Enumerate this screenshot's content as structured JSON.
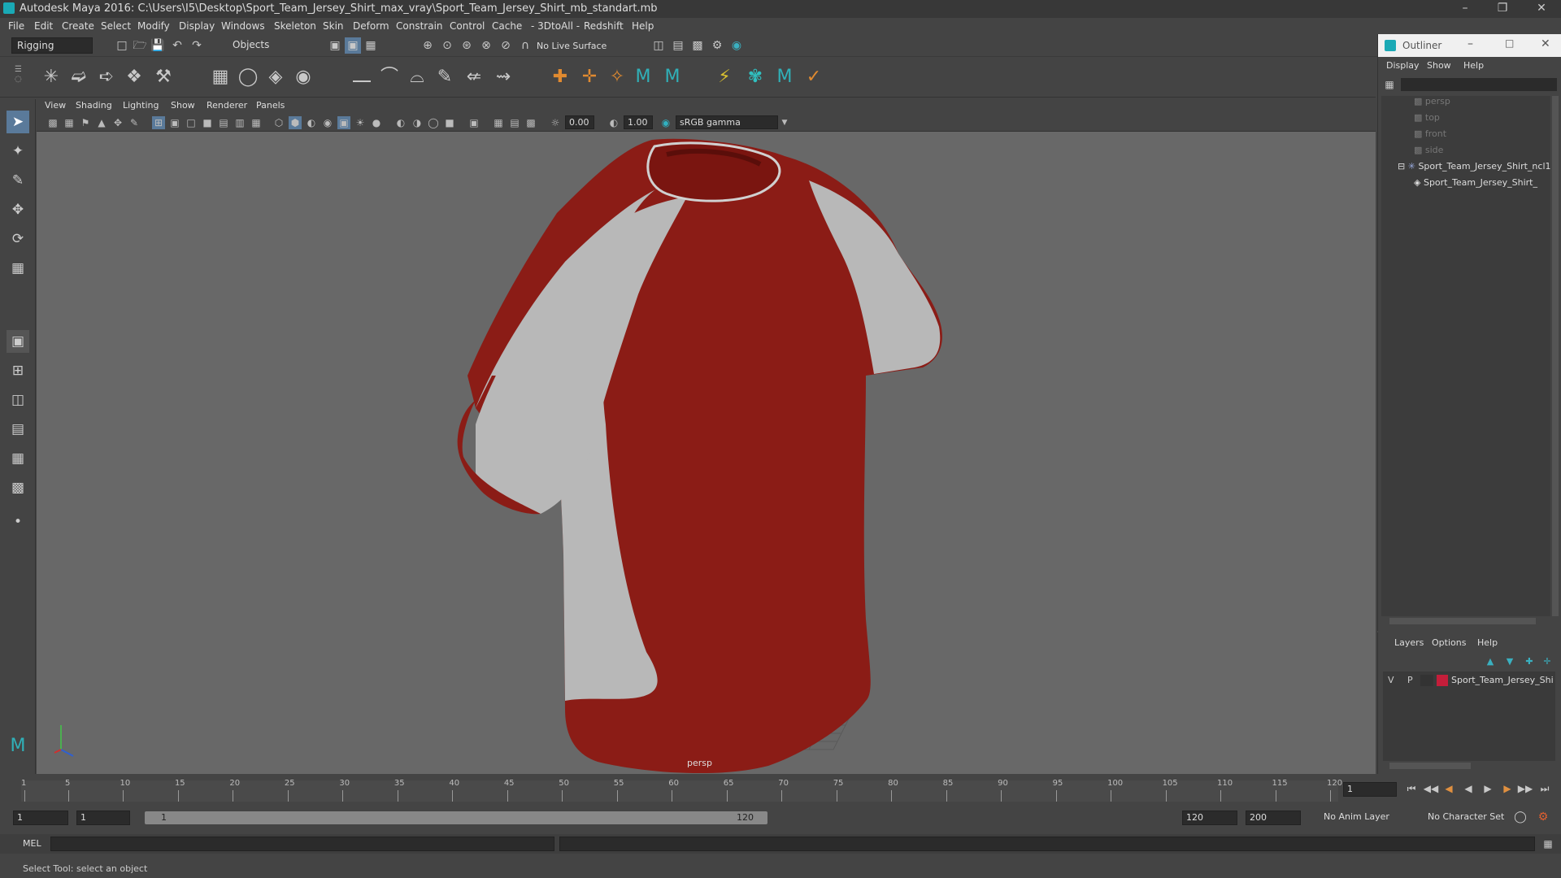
{
  "title": "Autodesk Maya 2016: C:\\Users\\I5\\Desktop\\Sport_Team_Jersey_Shirt_max_vray\\Sport_Team_Jersey_Shirt_mb_standart.mb",
  "menus": [
    "File",
    "Edit",
    "Create",
    "Select",
    "Modify",
    "Display",
    "Windows",
    "Skeleton",
    "Skin",
    "Deform",
    "Constrain",
    "Control",
    "Cache",
    "- 3DtoAll -",
    "Redshift",
    "Help"
  ],
  "status": {
    "mode": "Rigging",
    "selection": "Objects",
    "live_surface": "No Live Surface"
  },
  "viewport": {
    "menus": [
      "View",
      "Shading",
      "Lighting",
      "Show",
      "Renderer",
      "Panels"
    ],
    "exposure": "0.00",
    "gamma": "1.00",
    "color_space": "sRGB gamma",
    "camera_label": "persp"
  },
  "timeline": {
    "ticks": [
      "1",
      "5",
      "10",
      "15",
      "20",
      "25",
      "30",
      "35",
      "40",
      "45",
      "50",
      "55",
      "60",
      "65",
      "70",
      "75",
      "80",
      "85",
      "90",
      "95",
      "100",
      "105",
      "110",
      "115",
      "120"
    ],
    "current_frame": "1",
    "range_start": "1",
    "range_inner_start": "1",
    "range_slider_start": "1",
    "range_slider_end": "120",
    "range_inner_end": "120",
    "range_end": "200",
    "anim_layer": "No Anim Layer",
    "character_set": "No Character Set"
  },
  "cmd": {
    "lang": "MEL"
  },
  "help_text": "Select Tool: select an object",
  "outliner": {
    "title": "Outliner",
    "menus": [
      "Display",
      "Show",
      "Help"
    ],
    "items": [
      "persp",
      "top",
      "front",
      "side",
      "Sport_Team_Jersey_Shirt_ncl1",
      "Sport_Team_Jersey_Shirt_"
    ]
  },
  "layers": {
    "menus": [
      "Layers",
      "Options",
      "Help"
    ],
    "row": {
      "v": "V",
      "p": "P",
      "name": "Sport_Team_Jersey_Shi",
      "color": "#c41e3a"
    }
  },
  "colors": {
    "jersey_red": "#8b1c16",
    "jersey_white": "#b8b8b8",
    "viewport_bg": "#686868"
  }
}
